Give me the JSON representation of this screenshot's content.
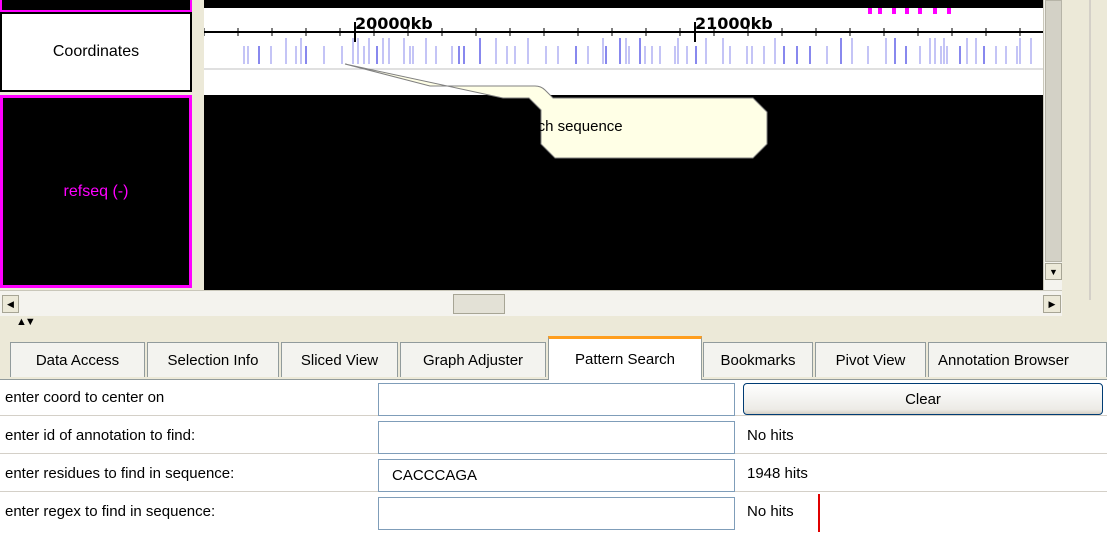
{
  "viewer": {
    "coordinates_label": "Coordinates",
    "track_label": "refseq (-)",
    "axis_ticks": [
      "20000kb",
      "21000kb"
    ],
    "callout_text": "Instances of your search sequence",
    "colors": {
      "hits": "#8888ee",
      "track_border": "#ff00ff",
      "track_bg": "#000000",
      "callout_bg": "#ffffe6"
    }
  },
  "tabs": [
    {
      "label": "Data Access",
      "active": false
    },
    {
      "label": "Selection Info",
      "active": false
    },
    {
      "label": "Sliced View",
      "active": false
    },
    {
      "label": "Graph Adjuster",
      "active": false
    },
    {
      "label": "Pattern Search",
      "active": true
    },
    {
      "label": "Bookmarks",
      "active": false
    },
    {
      "label": "Pivot View",
      "active": false
    },
    {
      "label": "Annotation Browser",
      "active": false
    }
  ],
  "form": {
    "coord_label": "enter coord to center on",
    "coord_value": "",
    "clear_button": "Clear",
    "id_label": "enter id of annotation to find:",
    "id_value": "",
    "id_result": "No hits",
    "residues_label": "enter residues to find in sequence:",
    "residues_value": "CACCCAGA",
    "residues_result": "1948 hits",
    "regex_label": "enter regex to find in sequence:",
    "regex_value": "",
    "regex_result": "No hits"
  },
  "icons": {
    "scroll_down": "scroll-down-arrow-icon",
    "scroll_left": "scroll-left-arrow-icon",
    "scroll_right": "scroll-right-arrow-icon",
    "splitter": "splitter-arrows-icon"
  }
}
